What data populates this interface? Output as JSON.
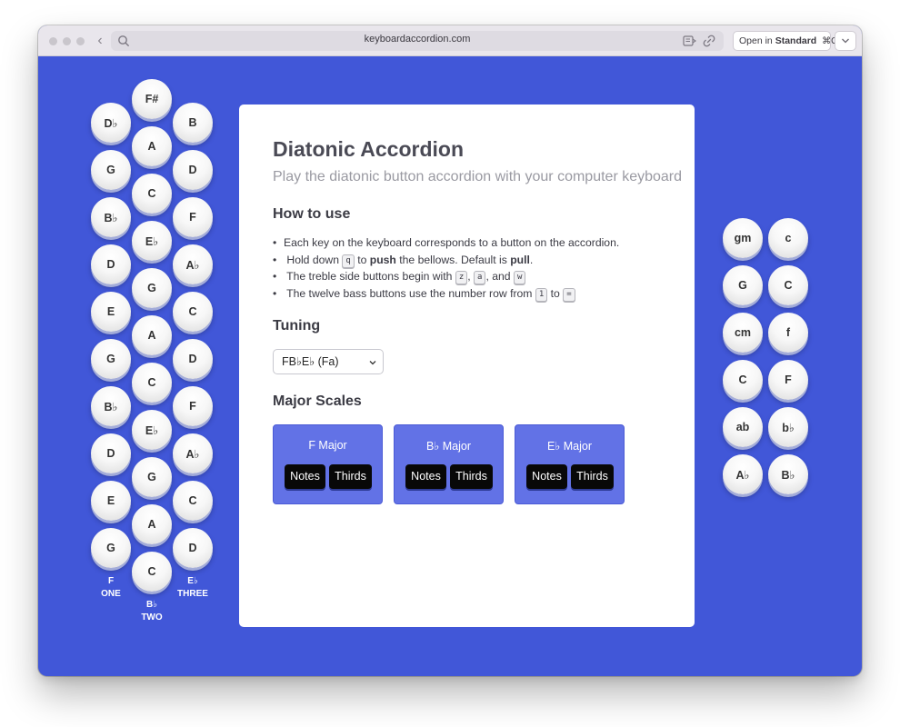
{
  "browser": {
    "url": "keyboardaccordion.com",
    "open_in_prefix": "Open in",
    "open_in_target": "Standard",
    "open_in_shortcut": "⌘O"
  },
  "treble": {
    "columns": [
      {
        "notes": [
          "D♭",
          "G",
          "B♭",
          "D",
          "E",
          "G",
          "B♭",
          "D",
          "E",
          "G"
        ],
        "label_key": "F",
        "label_name": "ONE"
      },
      {
        "notes": [
          "F#",
          "A",
          "C",
          "E♭",
          "G",
          "A",
          "C",
          "E♭",
          "G",
          "A",
          "C"
        ],
        "label_key": "B♭",
        "label_name": "TWO"
      },
      {
        "notes": [
          "B",
          "D",
          "F",
          "A♭",
          "C",
          "D",
          "F",
          "A♭",
          "C",
          "D"
        ],
        "label_key": "E♭",
        "label_name": "THREE"
      }
    ]
  },
  "bass": {
    "columns": [
      {
        "notes": [
          "gm",
          "G",
          "cm",
          "C",
          "ab",
          "A♭"
        ]
      },
      {
        "notes": [
          "c",
          "C",
          "f",
          "F",
          "b♭",
          "B♭"
        ]
      }
    ]
  },
  "content": {
    "title": "Diatonic Accordion",
    "subtitle": "Play the diatonic button accordion with your computer keyboard",
    "how_to_use": {
      "heading": "How to use",
      "line1": "Each key on the keyboard corresponds to a button on the accordion.",
      "line2_a": "Hold down",
      "line2_key": "q",
      "line2_b": "to",
      "line2_bold1": "push",
      "line2_c": "the bellows. Default is",
      "line2_bold2": "pull",
      "line2_d": ".",
      "line3_a": "The treble side buttons begin with",
      "line3_k1": "z",
      "line3_sep1": ",",
      "line3_k2": "a",
      "line3_sep2": ", and",
      "line3_k3": "w",
      "line4_a": "The twelve bass buttons use the number row from",
      "line4_k1": "1",
      "line4_b": "to",
      "line4_k2": "="
    },
    "tuning": {
      "heading": "Tuning",
      "selected": "FB♭E♭ (Fa)"
    },
    "scales": {
      "heading": "Major Scales",
      "items": [
        {
          "name": "F Major",
          "notes_label": "Notes",
          "thirds_label": "Thirds"
        },
        {
          "name": "B♭ Major",
          "notes_label": "Notes",
          "thirds_label": "Thirds"
        },
        {
          "name": "E♭ Major",
          "notes_label": "Notes",
          "thirds_label": "Thirds"
        }
      ]
    }
  }
}
